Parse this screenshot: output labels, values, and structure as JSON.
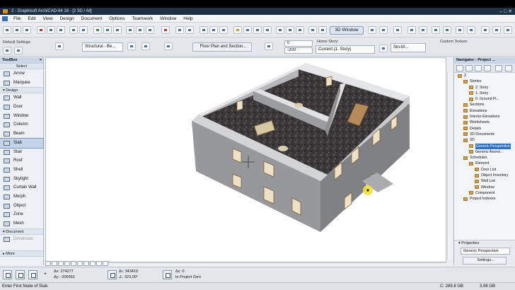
{
  "window": {
    "title": "2 - Graphisoft ArchiCAD-64 16 - [2 3D / All]"
  },
  "menu": [
    "File",
    "Edit",
    "View",
    "Design",
    "Document",
    "Options",
    "Teamwork",
    "Window",
    "Help"
  ],
  "toolbar": {
    "three_d_window_label": "3D Window"
  },
  "info_box": {
    "settings_label": "Default Settings",
    "structure_value": "Structural - Be...",
    "view_button": "Floor Plan and Section...",
    "top_value": "0",
    "bottom_value": "-200",
    "home_story_label": "Home Story:",
    "home_story_value": "Current (1. Story)",
    "custom_texture_label": "Custom Texture",
    "material_value": "Stn-M..."
  },
  "toolbox": {
    "title": "ToolBox",
    "select_label": "Select",
    "select_tools": [
      "Arrow",
      "Marquee"
    ],
    "design_label": "Design",
    "design_tools": [
      "Wall",
      "Door",
      "Window",
      "Column",
      "Beam",
      "Slab",
      "Stair",
      "Roof",
      "Shell",
      "Skylight",
      "Curtain Wall",
      "Morph",
      "Object",
      "Zone",
      "Mesh"
    ],
    "selected_tool": "Slab",
    "document_label": "Document",
    "document_tools": [
      "Dimension"
    ],
    "more_label": "More"
  },
  "navigator": {
    "title": "Navigator - Project ...",
    "tree": [
      {
        "label": "2",
        "level": 0
      },
      {
        "label": "Stories",
        "level": 1
      },
      {
        "label": "2. Story",
        "level": 2
      },
      {
        "label": "1. Story",
        "level": 2
      },
      {
        "label": "0. Ground Fl...",
        "level": 2
      },
      {
        "label": "Sections",
        "level": 1
      },
      {
        "label": "Elevations",
        "level": 1
      },
      {
        "label": "Interior Elevations",
        "level": 1
      },
      {
        "label": "Worksheets",
        "level": 1
      },
      {
        "label": "Details",
        "level": 1
      },
      {
        "label": "3D Documents",
        "level": 1
      },
      {
        "label": "3D",
        "level": 1
      },
      {
        "label": "Generic Perspective",
        "level": 2,
        "selected": true
      },
      {
        "label": "Generic Axono...",
        "level": 2
      },
      {
        "label": "Schedules",
        "level": 1
      },
      {
        "label": "Element",
        "level": 2
      },
      {
        "label": "Door List",
        "level": 3
      },
      {
        "label": "Object Inventory",
        "level": 3
      },
      {
        "label": "Wall List",
        "level": 3
      },
      {
        "label": "Window",
        "level": 3
      },
      {
        "label": "Component",
        "level": 2
      },
      {
        "label": "Project Indexes",
        "level": 1
      }
    ],
    "properties_label": "Properties",
    "properties_value": "Generic Perspective",
    "settings_button": "Settings..."
  },
  "coordinates": {
    "dx_label": "Δx:",
    "dx_value": "274277",
    "dy_label": "Δy:",
    "dy_value": "-206660",
    "r_label": "Δr:",
    "r_value": "343419",
    "angle_label": "∠:",
    "angle_value": "323,00°",
    "z_label": "Δz:",
    "z_value": "0",
    "ref_value": "to Project Zero"
  },
  "status": {
    "message": "Enter First Node of Slab.",
    "disk_label": "C: 289.8 GB",
    "memory_label": "3.98 GB"
  },
  "colors": {
    "titlebar": "#1e2f44",
    "wall": "#a4a6a9",
    "floor": "#3d3a3c",
    "selection": "#c3d4ea",
    "accent": "#e8d62a"
  }
}
